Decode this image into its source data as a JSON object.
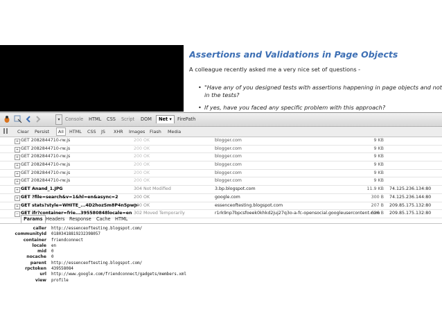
{
  "blog": {
    "title": "Assertions and Validations in Page Objects",
    "intro": "A colleague recently asked me a very nice set of questions -",
    "bullets": [
      "\"Have any of you designed tests with assertions happening in page objects and not in the tests?",
      "If yes, have you faced any specific problem with this approach?"
    ]
  },
  "firebug": {
    "main_tabs": [
      {
        "label": "Console"
      },
      {
        "label": "HTML"
      },
      {
        "label": "CSS"
      },
      {
        "label": "Script"
      },
      {
        "label": "DOM"
      },
      {
        "label": "Net ▾"
      },
      {
        "label": "FirePath"
      }
    ],
    "net_toolbar": [
      {
        "label": "Clear"
      },
      {
        "label": "Persist"
      },
      {
        "label": "All"
      },
      {
        "label": "HTML"
      },
      {
        "label": "CSS"
      },
      {
        "label": "JS"
      },
      {
        "label": "XHR"
      },
      {
        "label": "Images"
      },
      {
        "label": "Flash"
      },
      {
        "label": "Media"
      }
    ],
    "requests": [
      {
        "url": "GET 2082844710-rw.js",
        "status": "200 OK",
        "domain": "blogger.com",
        "size": "9 KB",
        "ip": "",
        "expander": "+"
      },
      {
        "url": "GET 2082844710-rw.js",
        "status": "200 OK",
        "domain": "blogger.com",
        "size": "9 KB",
        "ip": "",
        "expander": "+"
      },
      {
        "url": "GET 2082844710-rw.js",
        "status": "200 OK",
        "domain": "blogger.com",
        "size": "9 KB",
        "ip": "",
        "expander": "+"
      },
      {
        "url": "GET 2082844710-rw.js",
        "status": "200 OK",
        "domain": "blogger.com",
        "size": "9 KB",
        "ip": "",
        "expander": "+"
      },
      {
        "url": "GET 2082844710-rw.js",
        "status": "200 OK",
        "domain": "blogger.com",
        "size": "9 KB",
        "ip": "",
        "expander": "+"
      },
      {
        "url": "GET 2082844710-rw.js",
        "status": "200 OK",
        "domain": "blogger.com",
        "size": "9 KB",
        "ip": "",
        "expander": "+"
      },
      {
        "url": "GET Anand_1.JPG",
        "status": "304 Not Modified",
        "domain": "3.bp.blogspot.com",
        "size": "11.9 KB",
        "ip": "74.125.236.134:80",
        "expander": "+"
      },
      {
        "url": "GET ?file=search&v=1&hl=en&async=2",
        "status": "200 OK",
        "domain": "google.com",
        "size": "300 B",
        "ip": "74.125.236.144:80",
        "expander": "+"
      },
      {
        "url": "GET stats?style=WHITE_...4D2hozSm8P4n5pwp-",
        "status": "200 OK",
        "domain": "essenceoftesting.blogspot.com",
        "size": "207 B",
        "ip": "209.85.175.132:80",
        "expander": "+"
      },
      {
        "url": "GET ifr?container=frie...395580848locale=en",
        "status": "302 Moved Temporarily",
        "domain": "r1rk9np7bpcsfoeek0khkd2juj27q3o-a-fc-opensocial.googleusercontent.com",
        "size": "626 B",
        "ip": "209.85.175.132:80",
        "expander": "−"
      }
    ],
    "detail_tabs": [
      {
        "label": "Params"
      },
      {
        "label": "Headers"
      },
      {
        "label": "Response"
      },
      {
        "label": "Cache"
      },
      {
        "label": "HTML"
      }
    ],
    "params": [
      {
        "name": "caller",
        "value": "http://essenceoftesting.blogspot.com/"
      },
      {
        "name": "communityId",
        "value": "01803418819232398057"
      },
      {
        "name": "container",
        "value": "friendconnect"
      },
      {
        "name": "locale",
        "value": "en"
      },
      {
        "name": "mid",
        "value": "0"
      },
      {
        "name": "nocache",
        "value": "0"
      },
      {
        "name": "parent",
        "value": "http://essenceoftesting.blogspot.com/"
      },
      {
        "name": "rpctoken",
        "value": "439558084"
      },
      {
        "name": "url",
        "value": "http://www.google.com/friendconnect/gadgets/members.xml"
      },
      {
        "name": "view",
        "value": "profile"
      }
    ]
  }
}
